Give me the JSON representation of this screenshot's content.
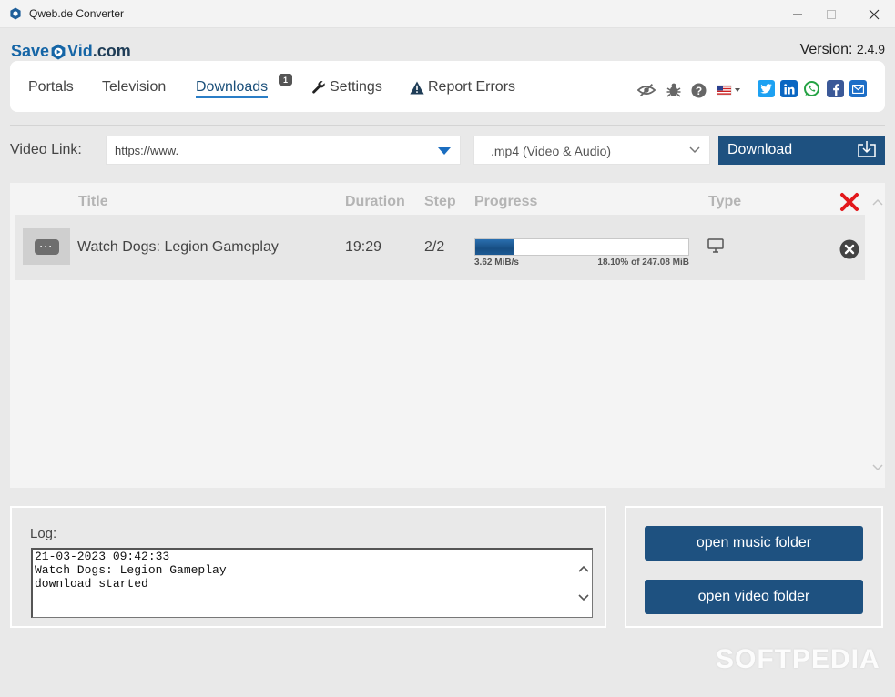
{
  "window": {
    "title": "Qweb.de Converter"
  },
  "header": {
    "logo_save": "Save",
    "logo_vid": "Vid",
    "logo_com": ".com",
    "version_label": "Version:",
    "version_number": "2.4.9"
  },
  "nav": {
    "portals": "Portals",
    "television": "Television",
    "downloads": "Downloads",
    "downloads_badge": "1",
    "settings": "Settings",
    "report_errors": "Report Errors"
  },
  "toolbar_icons": [
    "eye-slash-icon",
    "bug-icon",
    "help-icon",
    "flag-us-icon",
    "twitter-icon",
    "linkedin-icon",
    "whatsapp-icon",
    "facebook-icon",
    "email-icon"
  ],
  "input_row": {
    "video_link_label": "Video Link:",
    "url_value": "https://www.",
    "format_value": ".mp4 (Video & Audio)",
    "download_label": "Download"
  },
  "table": {
    "columns": [
      "Title",
      "Duration",
      "Step",
      "Progress",
      "Type"
    ],
    "rows": [
      {
        "title": "Watch Dogs: Legion Gameplay",
        "duration": "19:29",
        "step": "2/2",
        "speed": "3.62 MiB/s",
        "progress_text": "18.10% of 247.08 MiB",
        "progress_percent": 18.1,
        "type_icon": "monitor-icon"
      }
    ]
  },
  "log": {
    "label": "Log:",
    "lines": "21-03-2023 09:42:33\nWatch Dogs: Legion Gameplay\ndownload started"
  },
  "folders": {
    "music": "open music folder",
    "video": "open video folder"
  },
  "watermark": "SOFTPEDIA",
  "colors": {
    "accent": "#1e5180",
    "logo_blue": "#1565a6",
    "remove_red": "#e3171b"
  }
}
